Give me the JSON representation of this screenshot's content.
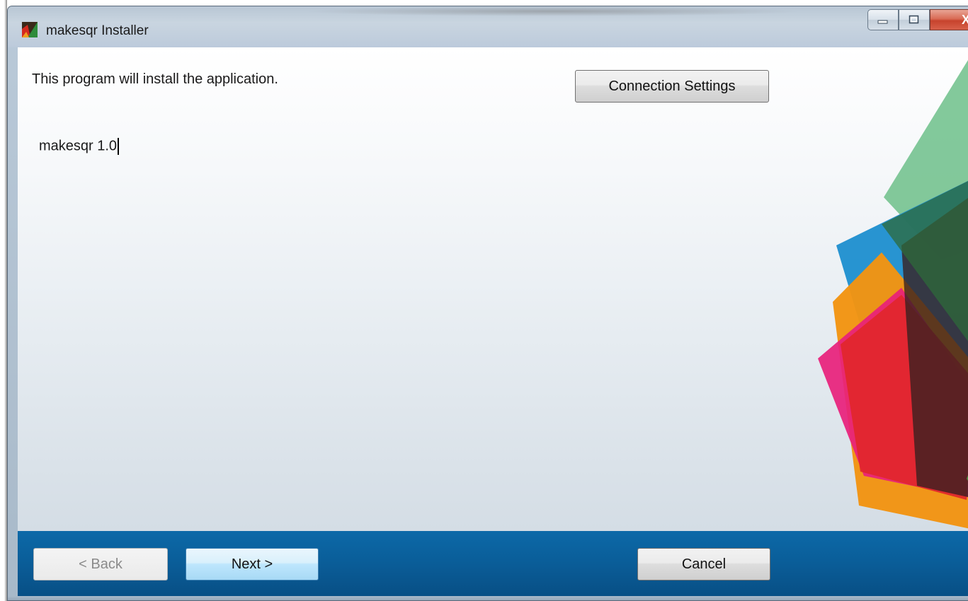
{
  "window": {
    "title": "makesqr Installer",
    "app_icon": "installer-app-icon"
  },
  "caption_buttons": {
    "minimize_icon": "minimize-icon",
    "maximize_icon": "maximize-icon",
    "close_label": "X"
  },
  "content": {
    "intro_text": "This program will install the application.",
    "connection_settings_label": "Connection Settings",
    "product_name": "makesqr 1.0"
  },
  "footer": {
    "back_label": "< Back",
    "back_enabled": false,
    "next_label": "Next >",
    "cancel_label": "Cancel"
  },
  "colors": {
    "footer_bg": "#0a5d98",
    "art_green": "#7cc794",
    "art_blue": "#1f8fcf",
    "art_orange": "#f29412",
    "art_red": "#e1262b",
    "art_pink": "#e8207b"
  }
}
